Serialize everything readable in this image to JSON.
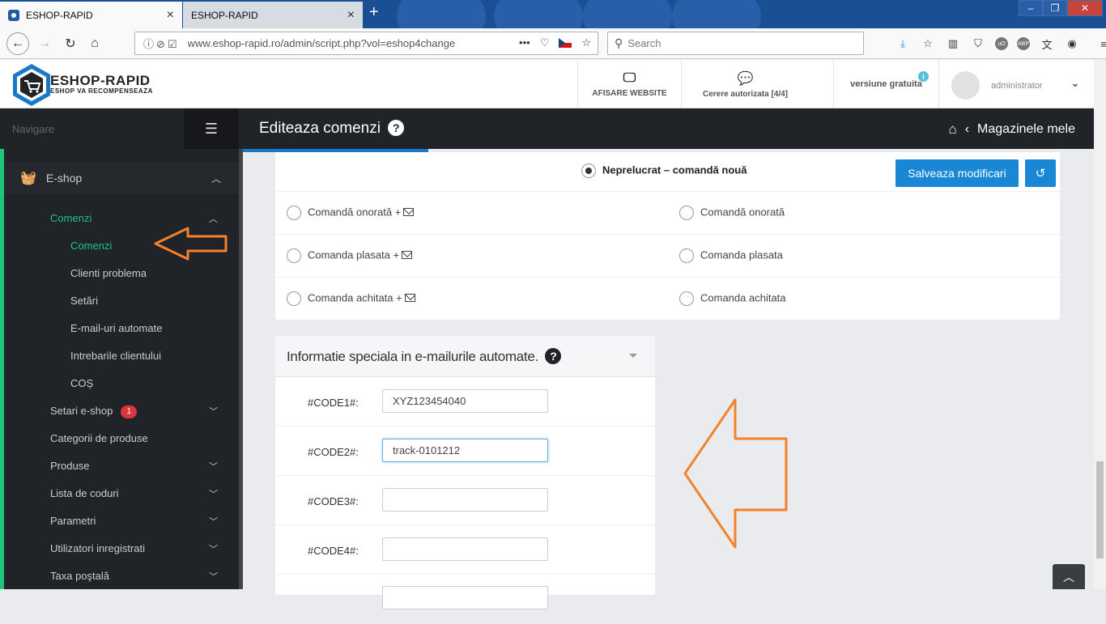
{
  "browser": {
    "tabs": [
      {
        "title": "ESHOP-RAPID",
        "active": true
      },
      {
        "title": "ESHOP-RAPID",
        "active": false
      }
    ],
    "url": "www.eshop-rapid.ro/admin/script.php?vol=eshop4change",
    "search_placeholder": "Search",
    "icons": [
      "back-icon",
      "forward-icon",
      "reload-icon",
      "home-icon",
      "download-icon",
      "star-icon",
      "library-icon",
      "shield-icon",
      "ublock-icon",
      "abp-icon",
      "translate-icon",
      "account-icon",
      "menu-icon"
    ]
  },
  "header": {
    "logo_title": "ESHOP-RAPID",
    "logo_subtitle": "ESHOP VA RECOMPENSEAZA",
    "btn_website": "AFISARE WEBSITE",
    "btn_requests": "Cerere autorizata [4/4]",
    "version": "versiune gratuita",
    "user": "administrator"
  },
  "sidebar": {
    "nav_label": "Navigare",
    "section": "E-shop",
    "group": "Comenzi",
    "subitems": [
      "Comenzi",
      "Clienti problema",
      "Setări",
      "E-mail-uri automate",
      "Intrebarile clientului",
      "COȘ"
    ],
    "items": [
      {
        "label": "Setari e-shop",
        "badge": "1"
      },
      {
        "label": "Categorii de produse"
      },
      {
        "label": "Produse"
      },
      {
        "label": "Lista de coduri"
      },
      {
        "label": "Parametri"
      },
      {
        "label": "Utilizatori inregistrati"
      },
      {
        "label": "Taxa poştală"
      }
    ]
  },
  "title": {
    "text": "Editeaza comenzi",
    "breadcrumb": "Magazinele mele"
  },
  "status": {
    "current": "Neprelucrat – comandă nouă",
    "save_label": "Salveaza modificari",
    "options_left": [
      "Comandă onorată +",
      "Comanda plasata +",
      "Comanda achitata +"
    ],
    "options_right": [
      "Comandă onorată",
      "Comanda plasata",
      "Comanda achitata"
    ]
  },
  "special": {
    "title": "Informatie speciala in e-mailurile automate.",
    "fields": [
      {
        "label": "#CODE1#:",
        "value": "XYZ123454040"
      },
      {
        "label": "#CODE2#:",
        "value": "track-0101212"
      },
      {
        "label": "#CODE3#:",
        "value": ""
      },
      {
        "label": "#CODE4#:",
        "value": ""
      }
    ]
  },
  "colors": {
    "accent": "#1a87d6",
    "sidebar": "#202327",
    "green": "#1ec67d",
    "arrow": "#f5822a"
  }
}
